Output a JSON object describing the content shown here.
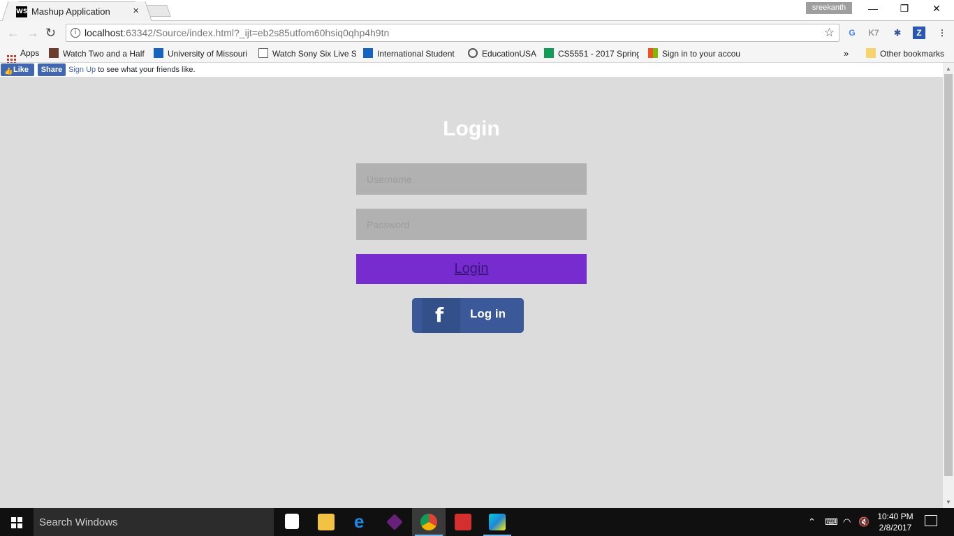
{
  "browser": {
    "tab": {
      "title": "Mashup Application",
      "favicon_text": "WS"
    },
    "user": "sreekanth",
    "window_controls": {
      "minimize": "—",
      "restore": "❐",
      "close": "✕"
    },
    "url": {
      "host": "localhost",
      "rest": ":63342/Source/index.html?_ijt=eb2s85utfom60hsiq0qhp4h9tn"
    },
    "bookmarks": [
      {
        "label": "Apps",
        "icon": "apps-grid-icon"
      },
      {
        "label": "Watch Two and a Half",
        "icon": "film-icon"
      },
      {
        "label": "University of Missouri",
        "icon": "mizzou-icon"
      },
      {
        "label": "Watch Sony Six Live S",
        "icon": "page-icon"
      },
      {
        "label": "International Student",
        "icon": "mizzou-icon"
      },
      {
        "label": "EducationUSA",
        "icon": "seal-icon"
      },
      {
        "label": "CS5551 - 2017 Spring",
        "icon": "sheets-icon"
      },
      {
        "label": "Sign in to your accou",
        "icon": "microsoft-icon"
      }
    ],
    "more_bookmarks": "»",
    "other_bookmarks": "Other bookmarks"
  },
  "fb_plugin": {
    "like": "Like",
    "share": "Share",
    "signup_link": "Sign Up",
    "signup_text": " to see what your friends like."
  },
  "login": {
    "title": "Login",
    "username_placeholder": "Username",
    "password_placeholder": "Password",
    "button": "Login",
    "fb_button": "Log in",
    "fb_letter": "f"
  },
  "taskbar": {
    "search": "Search Windows",
    "time": "10:40 PM",
    "date": "2/8/2017"
  },
  "colors": {
    "page_bg": "#dcdcdc",
    "login_button": "#772ccf",
    "facebook": "#3b5998"
  }
}
